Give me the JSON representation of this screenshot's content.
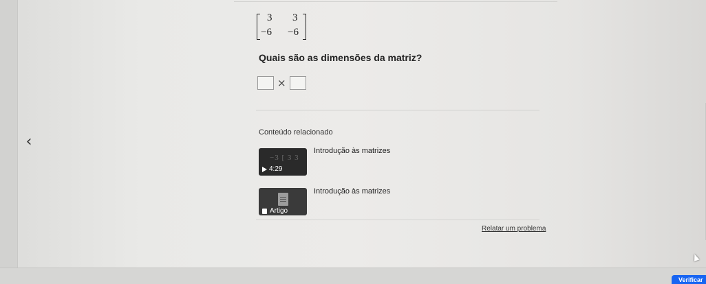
{
  "problem": {
    "matrix": [
      [
        "3",
        "3"
      ],
      [
        "−6",
        "−6"
      ]
    ],
    "question": "Quais são as dimensões da matriz?",
    "times_symbol": "×"
  },
  "related": {
    "heading": "Conteúdo relacionado",
    "items": [
      {
        "title": "Introdução às matrizes",
        "type": "video",
        "duration": "4:29",
        "thumb_text": "−3 [ 3  3"
      },
      {
        "title": "Introdução às matrizes",
        "type": "article",
        "badge": "Artigo"
      }
    ]
  },
  "footer": {
    "report_link": "Relatar um problema",
    "verify_button": "Verificar"
  },
  "icons": {
    "prev": "chevron-left-icon",
    "play": "play-icon",
    "document": "document-icon",
    "cursor": "mouse-cursor-icon"
  },
  "colors": {
    "accent": "#1865f2",
    "text": "#222222"
  }
}
